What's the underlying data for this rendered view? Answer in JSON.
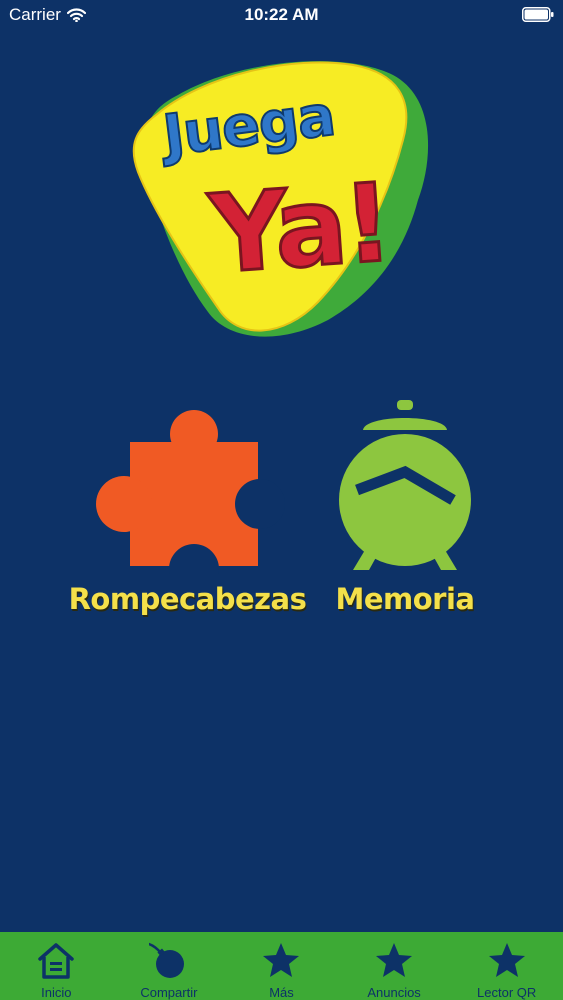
{
  "status_bar": {
    "carrier": "Carrier",
    "time": "10:22 AM"
  },
  "logo": {
    "line1": "Juega",
    "line2": "Ya!",
    "colors": {
      "blue_text": "#2f77c9",
      "red_text": "#d32235",
      "yellow_shape": "#f7ec24",
      "green_shape": "#3faa3a"
    }
  },
  "games": [
    {
      "label": "Rompecabezas",
      "icon": "puzzle-piece-icon",
      "color": "#f05a24"
    },
    {
      "label": "Memoria",
      "icon": "alarm-clock-icon",
      "color": "#8dc63f"
    }
  ],
  "tab_bar": {
    "background": "#3daa35",
    "tabs": [
      {
        "label": "Inicio",
        "icon": "home-icon"
      },
      {
        "label": "Compartir",
        "icon": "bomb-icon"
      },
      {
        "label": "Más",
        "icon": "star-icon"
      },
      {
        "label": "Anuncios",
        "icon": "star-icon"
      },
      {
        "label": "Lector QR",
        "icon": "star-icon"
      }
    ]
  },
  "theme": {
    "background": "#0d3267",
    "label_color": "#f4e04a"
  }
}
